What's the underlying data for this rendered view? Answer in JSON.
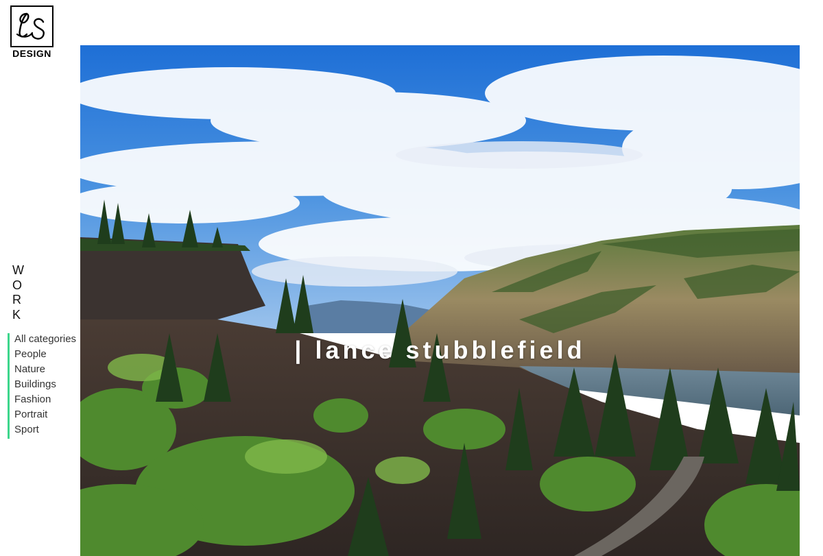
{
  "brand": {
    "logo_mark": "LS",
    "logo_text": "DESIGN"
  },
  "work_label": [
    "W",
    "O",
    "R",
    "K"
  ],
  "categories": [
    {
      "label": "All categories"
    },
    {
      "label": "People"
    },
    {
      "label": "Nature"
    },
    {
      "label": "Buildings"
    },
    {
      "label": "Fashion"
    },
    {
      "label": "Portrait"
    },
    {
      "label": "Sport"
    }
  ],
  "hero": {
    "title": "| lance stubblefield",
    "image_subject": "landscape-photo"
  },
  "colors": {
    "accent": "#3dd68c",
    "sky": "#2f7fd8",
    "text": "#333333"
  }
}
